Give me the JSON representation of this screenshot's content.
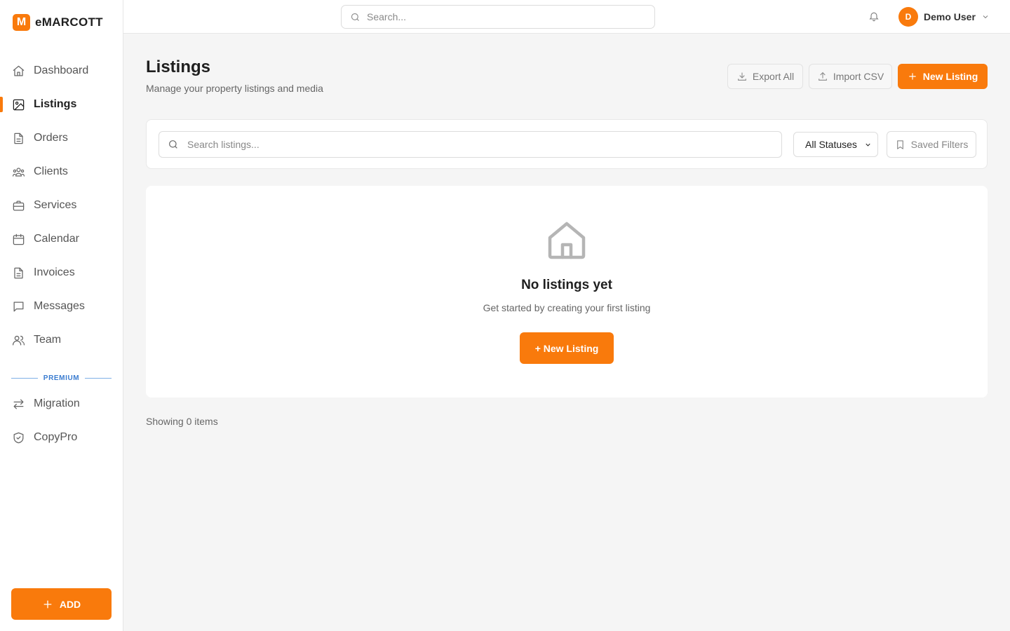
{
  "brand": {
    "logo_letter": "M",
    "name": "eMARCOTT",
    "accent_color": "#f97a0c"
  },
  "sidebar": {
    "items": [
      {
        "label": "Dashboard",
        "icon": "home-icon"
      },
      {
        "label": "Listings",
        "icon": "image-icon",
        "active": true
      },
      {
        "label": "Orders",
        "icon": "file-icon"
      },
      {
        "label": "Clients",
        "icon": "users-group-icon"
      },
      {
        "label": "Services",
        "icon": "briefcase-icon"
      },
      {
        "label": "Calendar",
        "icon": "calendar-icon"
      },
      {
        "label": "Invoices",
        "icon": "file-icon"
      },
      {
        "label": "Messages",
        "icon": "message-icon"
      },
      {
        "label": "Team",
        "icon": "team-icon"
      }
    ],
    "premium_label": "PREMIUM",
    "premium_items": [
      {
        "label": "Migration",
        "icon": "arrows-swap-icon"
      },
      {
        "label": "CopyPro",
        "icon": "shield-check-icon"
      }
    ],
    "add_label": "ADD"
  },
  "topbar": {
    "search_placeholder": "Search...",
    "user_initial": "D",
    "user_name": "Demo User"
  },
  "page": {
    "title": "Listings",
    "subtitle": "Manage your property listings and media",
    "export_label": "Export All",
    "import_label": "Import CSV",
    "new_listing_label": "New Listing"
  },
  "filters": {
    "search_placeholder": "Search listings...",
    "status_selected": "All Statuses",
    "saved_filters_label": "Saved Filters"
  },
  "empty_state": {
    "title": "No listings yet",
    "subtitle": "Get started by creating your first listing",
    "button_label": "+ New Listing"
  },
  "footer": {
    "showing_text": "Showing 0 items"
  }
}
